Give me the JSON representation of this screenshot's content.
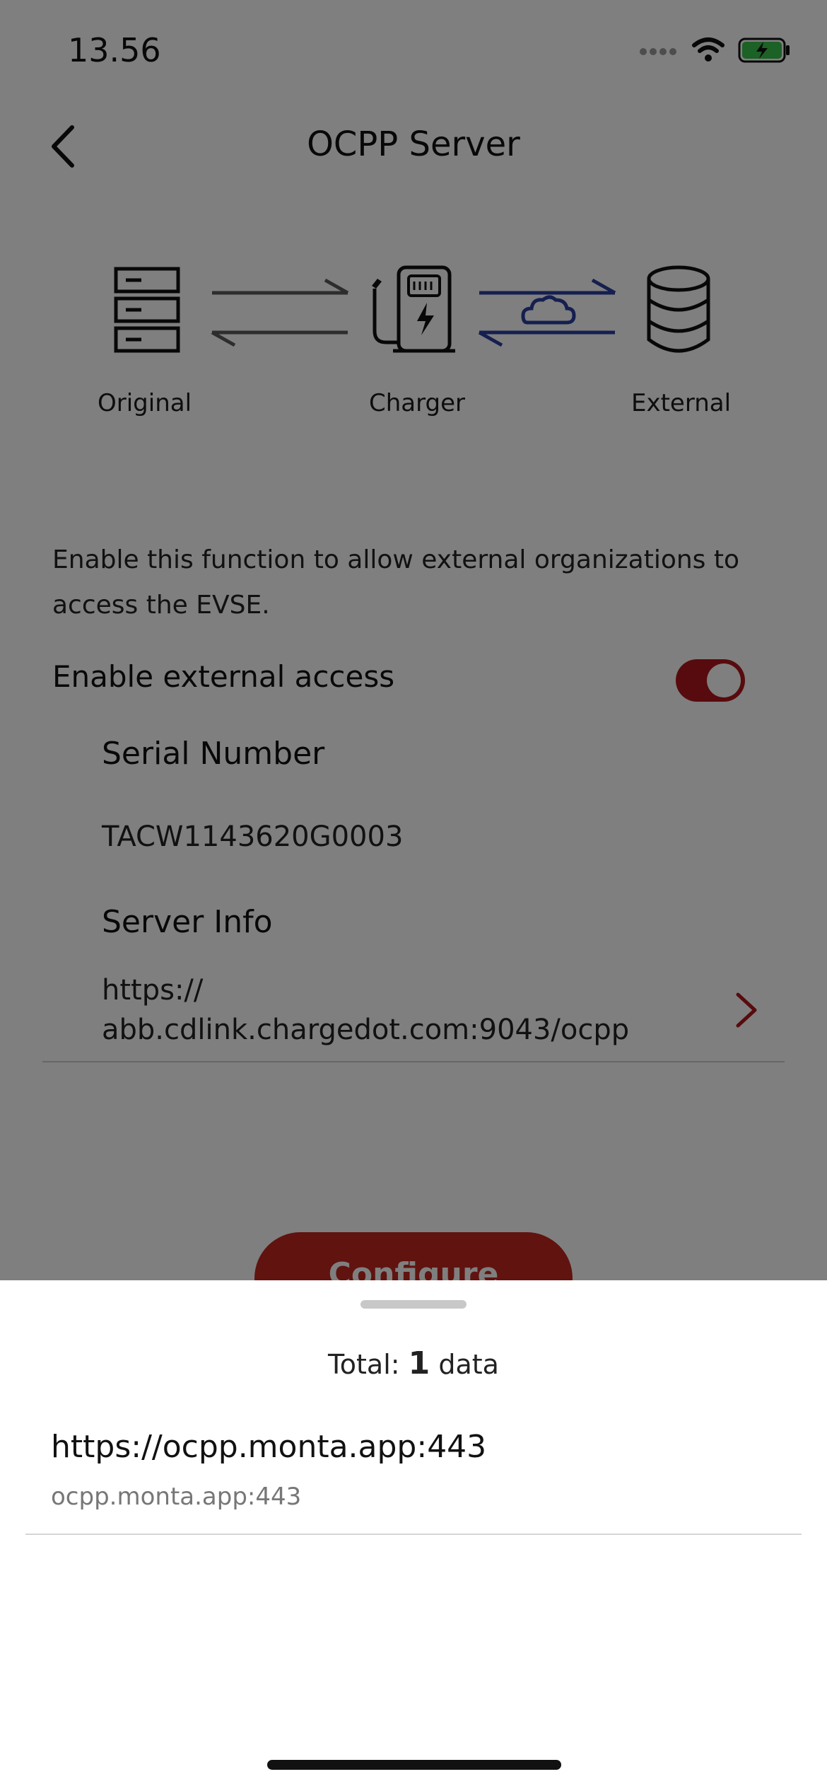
{
  "status": {
    "time": "13.56"
  },
  "nav": {
    "title": "OCPP Server"
  },
  "diagram": {
    "labels": {
      "original": "Original",
      "charger": "Charger",
      "external": "External"
    },
    "colors": {
      "gray_arrows": "#5a5a5a",
      "blue_arrows": "#2b3fa0",
      "icons": "#111111"
    }
  },
  "content": {
    "description": "Enable this function to allow external organizations to access the EVSE.",
    "enable_label": "Enable external access",
    "enable_on": true,
    "serial_title": "Serial Number",
    "serial_value": "TACW1143620G0003",
    "server_title": "Server Info",
    "server_url_line1": "https://",
    "server_url_line2": "abb.cdlink.chargedot.com:9043/ocpp",
    "configure_label": "Configure"
  },
  "sheet": {
    "total_prefix": "Total: ",
    "total_count": "1",
    "total_suffix": " data",
    "items": [
      {
        "title": "https://ocpp.monta.app:443",
        "subtitle": "ocpp.monta.app:443"
      }
    ]
  },
  "colors": {
    "accent": "#b1161c",
    "overlay": "rgba(0,0,0,0.5)"
  }
}
